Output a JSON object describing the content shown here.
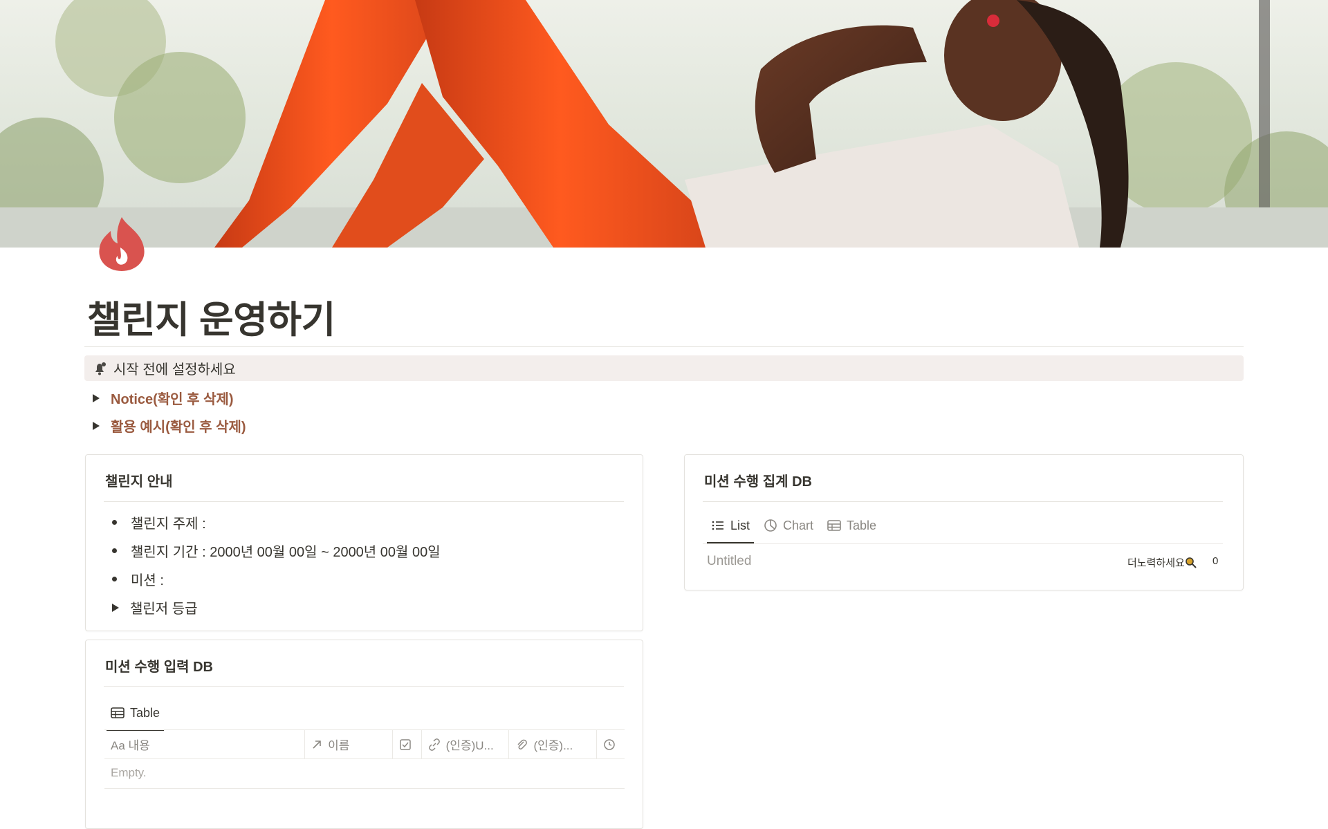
{
  "page": {
    "title": "챌린지 운영하기"
  },
  "callout": {
    "text": "시작 전에 설정하세요"
  },
  "toggles": [
    {
      "label": "Notice(확인 후 삭제)"
    },
    {
      "label": "활용 예시(확인 후 삭제)"
    }
  ],
  "challenge_info": {
    "title": "챌린지 안내",
    "items": [
      {
        "label": "챌린지 주제 :"
      },
      {
        "label": "챌린지 기간 : 2000년 00월 00일 ~ 2000년 00월 00일"
      },
      {
        "label": "미션 :"
      },
      {
        "label": "챌린저 등급"
      }
    ]
  },
  "mission_input_db": {
    "title": "미션 수행 입력 DB",
    "view_label": "Table",
    "columns": [
      {
        "label": "Aa 내용"
      },
      {
        "label": "이름"
      },
      {
        "label": ""
      },
      {
        "label": "(인증)U..."
      },
      {
        "label": "(인증)..."
      },
      {
        "label": ""
      }
    ],
    "empty_text": "Empty."
  },
  "mission_summary_db": {
    "title": "미션 수행 집계 DB",
    "tabs": [
      {
        "label": "List"
      },
      {
        "label": "Chart"
      },
      {
        "label": "Table"
      }
    ],
    "rows": [
      {
        "title": "Untitled",
        "tag": "더노력하세요",
        "count": "0"
      }
    ]
  },
  "colors": {
    "accent_brown": "#9a5a3f",
    "icon_red": "#d9534f",
    "callout_bg": "#f3eeec"
  }
}
